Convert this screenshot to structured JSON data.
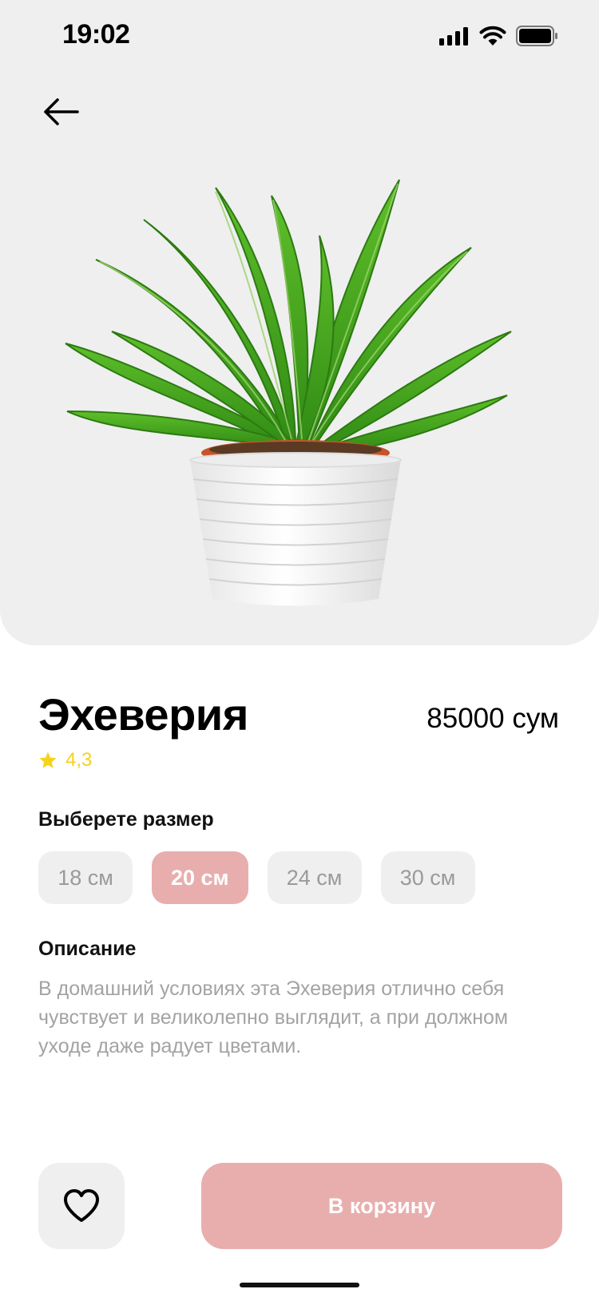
{
  "status_bar": {
    "time": "19:02",
    "icons": [
      "signal-icon",
      "wifi-icon",
      "battery-icon"
    ]
  },
  "nav": {
    "back_icon": "arrow-left-icon"
  },
  "product": {
    "name": "Эхеверия",
    "price": "85000 сум",
    "rating": "4,3",
    "image": "potted-plant"
  },
  "size_section": {
    "heading": "Выберете размер",
    "options": [
      "18 см",
      "20 см",
      "24 см",
      "30 см"
    ],
    "selected": "20 см"
  },
  "description": {
    "heading": "Описание",
    "text": "В домашний условиях эта Эхеверия отлично себя чувствует и великолепно выглядит, а при должном уходе даже радует цветами."
  },
  "actions": {
    "favorite_icon": "heart-icon",
    "cart_label": "В корзину"
  },
  "colors": {
    "accent": "#e8aeae",
    "hero_bg": "#efefef",
    "star": "#f6d21a",
    "muted_text": "#a3a3a3"
  }
}
